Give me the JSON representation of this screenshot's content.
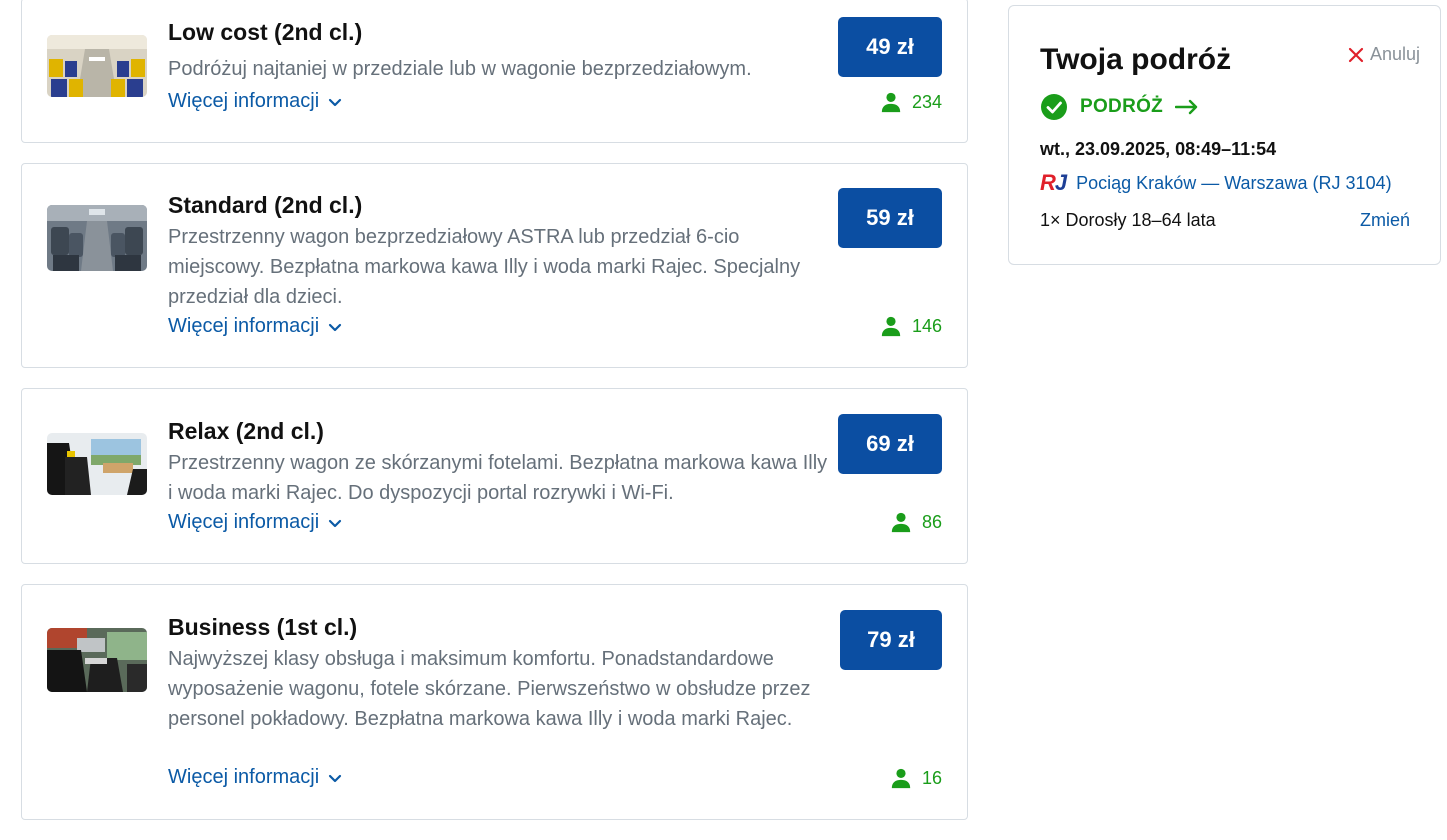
{
  "fares": [
    {
      "title": "Low cost (2nd cl.)",
      "description": "Podróżuj najtaniej w przedziale lub w wagonie bezprzedziałowym.",
      "more_label": "Więcej informacji",
      "price": "49 zł",
      "seats": "234",
      "image": "low-cost-wagon-photo"
    },
    {
      "title": "Standard (2nd cl.)",
      "description": "Przestrzenny wagon bezprzedziałowy ASTRA lub przedział 6-cio miejscowy. Bezpłatna markowa kawa Illy i woda marki Rajec. Specjalny przedział dla dzieci.",
      "more_label": "Więcej informacji",
      "price": "59 zł",
      "seats": "146",
      "image": "standard-wagon-photo"
    },
    {
      "title": "Relax (2nd cl.)",
      "description": "Przestrzenny wagon ze skórzanymi fotelami. Bezpłatna markowa kawa Illy i woda marki Rajec. Do dyspozycji portal rozrywki i Wi-Fi.",
      "more_label": "Więcej informacji",
      "price": "69 zł",
      "seats": "86",
      "image": "relax-wagon-photo"
    },
    {
      "title": "Business (1st cl.)",
      "description": "Najwyższej klasy obsługa i maksimum komfortu. Ponadstandardowe wyposażenie wagonu, fotele skórzane. Pierwszeństwo w obsłudze przez personel pokładowy. Bezpłatna markowa kawa Illy i woda marki Rajec.",
      "more_label": "Więcej informacji",
      "price": "79 zł",
      "seats": "16",
      "image": "business-wagon-photo"
    }
  ],
  "trip": {
    "title": "Twoja podróż",
    "cancel_label": "Anuluj",
    "leg_label": "PODRÓŻ",
    "date": "wt., 23.09.2025, 08:49–11:54",
    "carrier_logo": "RJ",
    "train": "Pociąg Kraków — Warszawa (RJ 3104)",
    "passengers": "1× Dorosły 18–64 lata",
    "change_label": "Zmień"
  },
  "colors": {
    "primary": "#0b4ea2",
    "link": "#0b5aa6",
    "success": "#1a9d1a",
    "muted": "#66707a",
    "border": "#d7dde3",
    "cancel": "#e0202a",
    "rj_red": "#e0202a",
    "rj_blue": "#1e3f96"
  }
}
